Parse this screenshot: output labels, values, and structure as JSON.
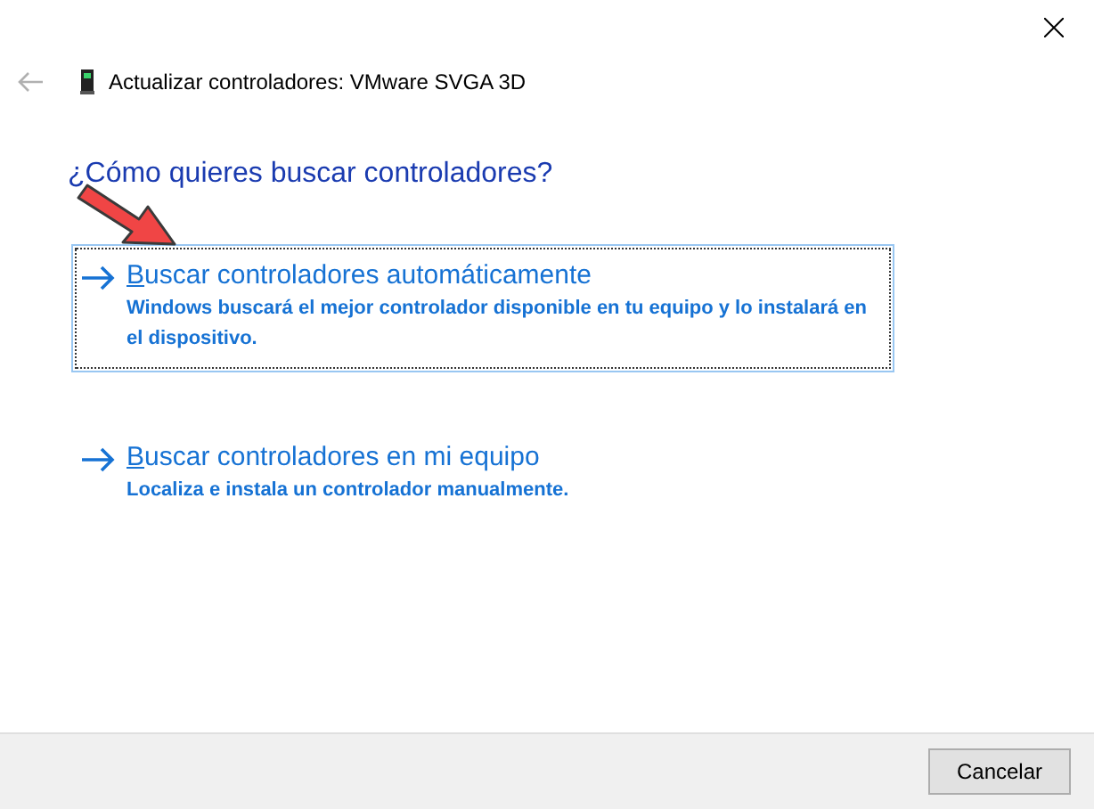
{
  "window": {
    "title": "Actualizar controladores: VMware SVGA 3D"
  },
  "heading": "¿Cómo quieres buscar controladores?",
  "options": [
    {
      "title": "Buscar controladores automáticamente",
      "description": "Windows buscará el mejor controlador disponible en tu equipo y lo instalará en el dispositivo.",
      "selected": true
    },
    {
      "title": "Buscar controladores en mi equipo",
      "description": "Localiza e instala un controlador manualmente.",
      "selected": false
    }
  ],
  "buttons": [
    "Cancelar"
  ]
}
